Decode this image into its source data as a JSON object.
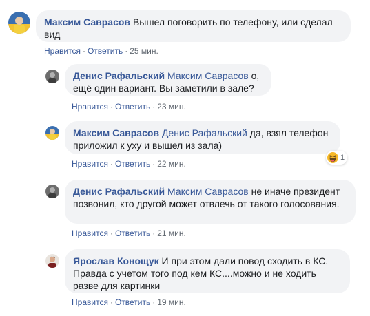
{
  "comments": [
    {
      "author": "Максим Саврасов",
      "mention": "",
      "text": "Вышел поговорить по телефону, или сделал вид",
      "like": "Нравится",
      "reply": "Ответить",
      "time": "25 мин."
    },
    {
      "author": "Денис Рафальский",
      "mention": "Максим Саврасов",
      "text": "о, ещё один вариант. Вы заметили в зале?",
      "like": "Нравится",
      "reply": "Ответить",
      "time": "23 мин."
    },
    {
      "author": "Максим Саврасов",
      "mention": "Денис Рафальский",
      "text": "да, взял телефон приложил к уху и вышел из зала)",
      "like": "Нравится",
      "reply": "Ответить",
      "time": "22 мин.",
      "reaction": {
        "icon": "haha-emoji-icon",
        "count": "1"
      }
    },
    {
      "author": "Денис Рафальский",
      "mention": "Максим Саврасов",
      "text": "не иначе президент позвонил, кто другой может отвлечь от такого голосования.",
      "like": "Нравится",
      "reply": "Ответить",
      "time": "21 мин."
    },
    {
      "author": "Ярослав Конощук",
      "mention": "",
      "text": "И при этом дали повод сходить в КС. Правда с учетом того под кем КС....можно и не ходить разве для картинки",
      "like": "Нравится",
      "reply": "Ответить",
      "time": "19 мин."
    }
  ],
  "colors": {
    "link": "#385898",
    "bubble": "#f2f3f5",
    "meta": "#606770"
  }
}
